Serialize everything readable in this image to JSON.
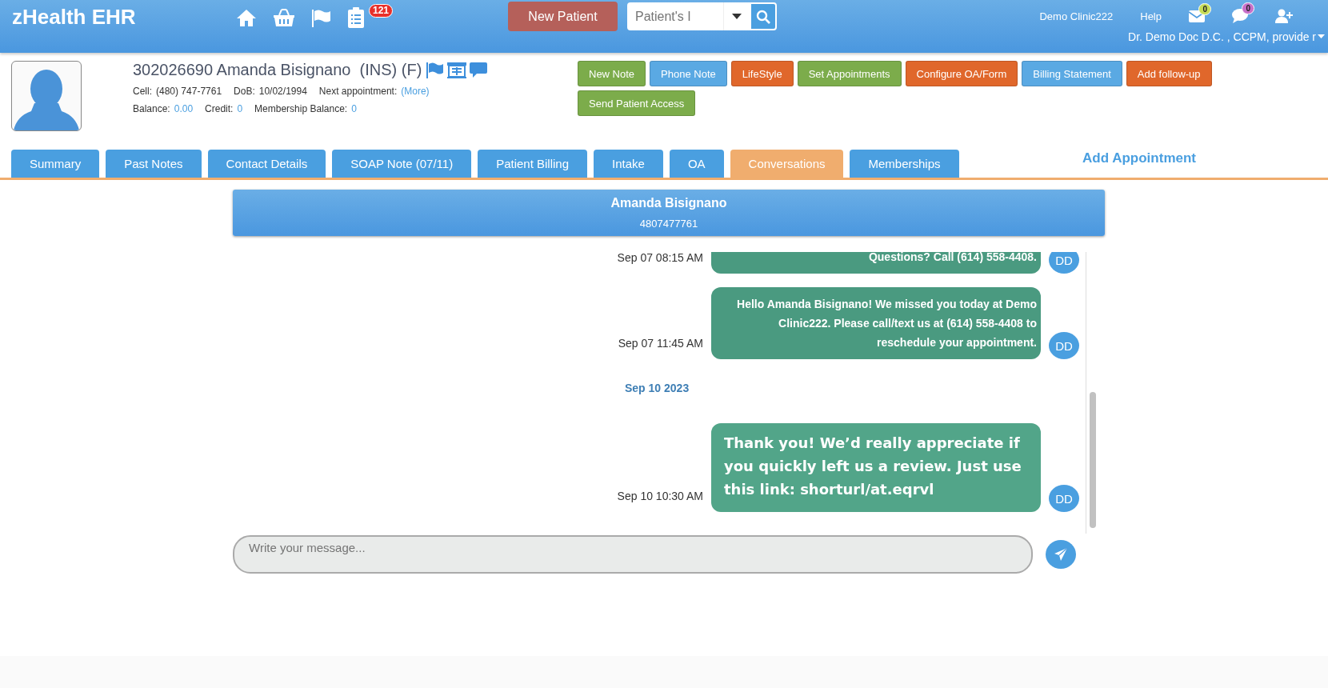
{
  "topbar": {
    "brand": "zHealth EHR",
    "icons": [
      {
        "kind": "home"
      },
      {
        "kind": "basket"
      },
      {
        "kind": "flag"
      },
      {
        "kind": "clipboard",
        "badge": "121",
        "color": "#e8302a"
      }
    ],
    "new_patient": "New Patient",
    "search": {
      "placeholder": "Patient's I"
    },
    "clinic": "Demo Clinic222",
    "help": "Help",
    "right_icons": [
      {
        "kind": "mail",
        "badge": "0",
        "color": "#c6dc56"
      },
      {
        "kind": "chat",
        "badge": "0",
        "color": "#c86fc8"
      },
      {
        "kind": "add-user"
      }
    ],
    "user": "Dr. Demo Doc D.C. , CCPM, provide r"
  },
  "patient": {
    "title": "302026690 Amanda Bisignano  (INS) (F)",
    "cell_label": "Cell:",
    "cell": "(480) 747-7761",
    "dob_label": "DoB:",
    "dob": "10/02/1994",
    "next_label": "Next appointment:",
    "next_link": "(More)",
    "balance_label": "Balance:",
    "balance": "0.00",
    "credit_label": "Credit:",
    "credit": "0",
    "membership_label": "Membership Balance:",
    "membership": "0"
  },
  "actions": [
    {
      "label": "New Note",
      "color": "#7cac4b"
    },
    {
      "label": "Phone Note",
      "color": "#5aa9e3"
    },
    {
      "label": "LifeStyle",
      "color": "#e0672b"
    },
    {
      "label": "Set Appointments",
      "color": "#7cac4b"
    },
    {
      "label": "Configure OA/Form",
      "color": "#e0672b"
    },
    {
      "label": "Billing Statement",
      "color": "#5aa9e3"
    },
    {
      "label": "Add follow-up",
      "color": "#e0672b"
    },
    {
      "label": "Send Patient Access",
      "color": "#7cac4b"
    }
  ],
  "tabs": [
    {
      "label": "Summary",
      "selected": false
    },
    {
      "label": "Past Notes",
      "selected": false
    },
    {
      "label": "Contact Details",
      "selected": false
    },
    {
      "label": "SOAP Note (07/11)",
      "selected": false
    },
    {
      "label": "Patient Billing",
      "selected": false
    },
    {
      "label": "Intake",
      "selected": false
    },
    {
      "label": "OA",
      "selected": false
    },
    {
      "label": "Conversations",
      "selected": true
    },
    {
      "label": "Memberships",
      "selected": false
    }
  ],
  "add_appointment": "Add Appointment",
  "conversation": {
    "name": "Amanda Bisignano",
    "phone": "4807477761",
    "items": [
      {
        "kind": "message",
        "time": "Sep 07 08:15 AM",
        "text": "Questions? Call (614) 558-4408.",
        "avatar": "DD"
      },
      {
        "kind": "message",
        "time": "Sep 07 11:45 AM",
        "text": "Hello Amanda Bisignano! We missed you today at Demo Clinic222. Please call/text us at (614) 558-4408 to reschedule your appointment.",
        "avatar": "DD"
      },
      {
        "kind": "date",
        "text": "Sep 10 2023"
      },
      {
        "kind": "typed",
        "time": "Sep 10 10:30 AM",
        "text": "Thank you! We’d really appreciate if you quickly left us a review. Just use this link: shorturl/at.eqrvl",
        "avatar": "DD"
      }
    ],
    "input": {
      "placeholder": "Write your message..."
    }
  }
}
